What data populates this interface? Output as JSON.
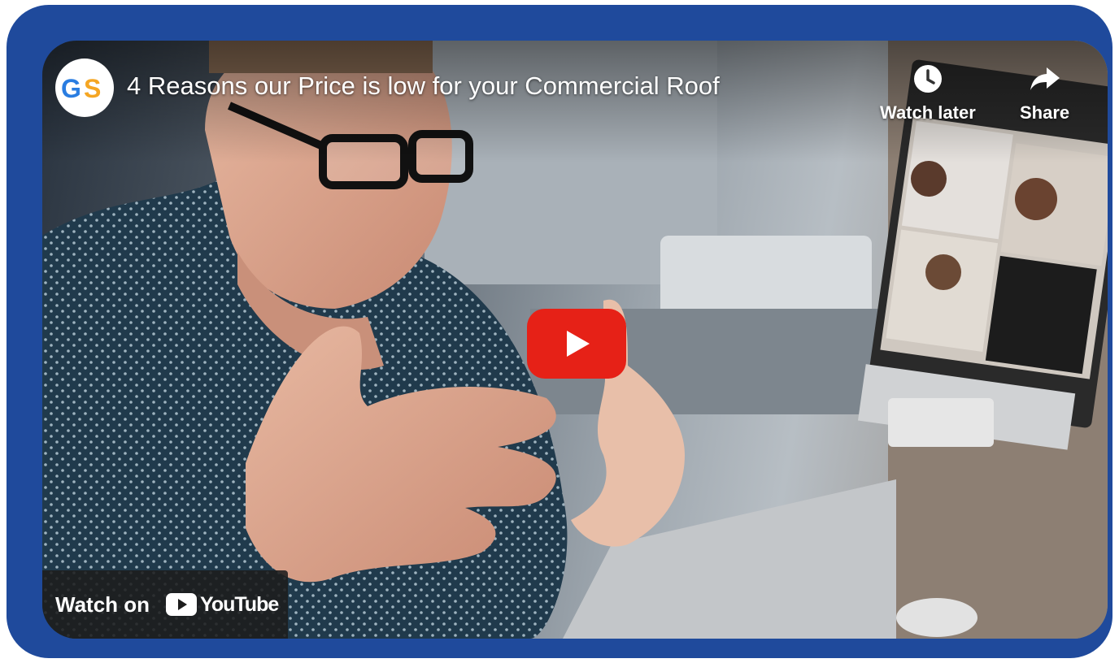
{
  "video": {
    "title": "4 Reasons our Price is low for your Commercial Roof",
    "channel_logo_text": "GS"
  },
  "actions": {
    "watch_later_label": "Watch later",
    "share_label": "Share"
  },
  "watch_on": {
    "label": "Watch on",
    "brand": "YouTube"
  },
  "colors": {
    "frame": "#1f4a9c",
    "play_button": "#e62117",
    "logo_blue": "#2a7de1",
    "logo_orange": "#f5a623"
  },
  "icons": {
    "watch_later": "clock-icon",
    "share": "share-arrow-icon",
    "play": "play-icon",
    "youtube": "youtube-logo-icon"
  }
}
